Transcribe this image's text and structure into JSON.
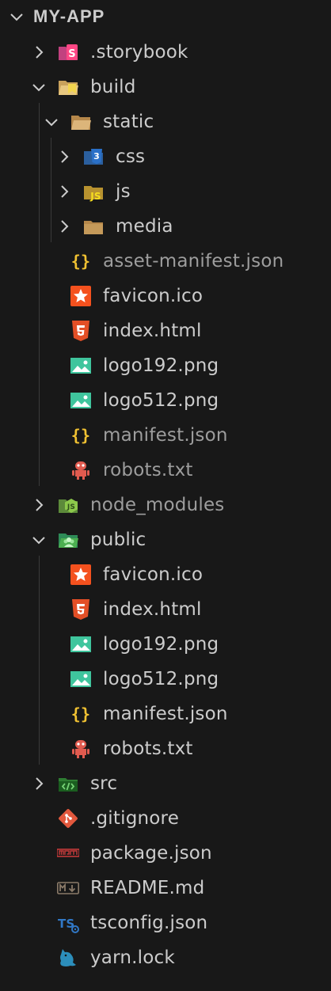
{
  "explorer": {
    "root_title": "MY-APP",
    "items": {
      "storybook": ".storybook",
      "build": "build",
      "static": "static",
      "css": "css",
      "js": "js",
      "media": "media",
      "asset_manifest": "asset-manifest.json",
      "build_favicon": "favicon.ico",
      "build_index": "index.html",
      "build_logo192": "logo192.png",
      "build_logo512": "logo512.png",
      "build_manifest": "manifest.json",
      "build_robots": "robots.txt",
      "node_modules": "node_modules",
      "public": "public",
      "public_favicon": "favicon.ico",
      "public_index": "index.html",
      "public_logo192": "logo192.png",
      "public_logo512": "logo512.png",
      "public_manifest": "manifest.json",
      "public_robots": "robots.txt",
      "src": "src",
      "gitignore": ".gitignore",
      "package_json": "package.json",
      "readme": "README.md",
      "tsconfig": "tsconfig.json",
      "yarn_lock": "yarn.lock"
    },
    "icon_names": {
      "storybook": "storybook-folder-icon",
      "build": "build-folder-open-icon",
      "static": "folder-open-icon",
      "css": "css-folder-icon",
      "js": "js-folder-icon",
      "media": "folder-icon",
      "json": "json-braces-icon",
      "favicon": "favicon-star-icon",
      "html": "html5-icon",
      "image": "image-icon",
      "robots": "robot-icon",
      "node_modules": "node-folder-icon",
      "public": "public-folder-open-icon",
      "src": "src-folder-icon",
      "git": "git-icon",
      "npm": "npm-icon",
      "markdown": "markdown-icon",
      "typescript": "typescript-icon",
      "yarn": "yarn-icon"
    },
    "colors": {
      "background": "#181818",
      "text": "#cccccc",
      "dim_text": "#9d9d9d",
      "json": "#f1c232",
      "html": "#e34f26",
      "image": "#3fc59d",
      "robot": "#e15b4f",
      "css": "#2a70c8",
      "folder": "#c59a5a",
      "git": "#e2583d",
      "npm": "#c43a3a",
      "typescript": "#3178c6",
      "yarn": "#2c8ebb"
    }
  }
}
